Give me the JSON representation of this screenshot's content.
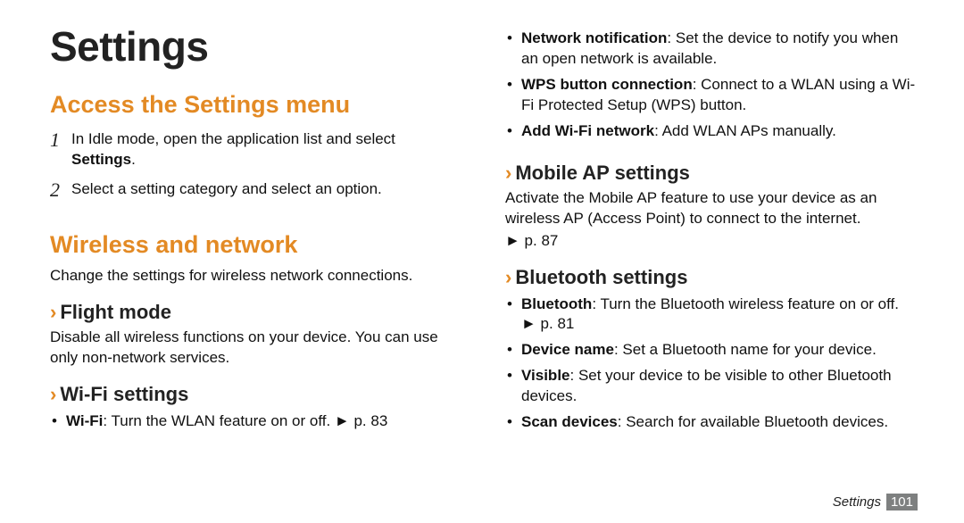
{
  "page_title": "Settings",
  "left": {
    "section1": {
      "heading": "Access the Settings menu",
      "steps": [
        {
          "num": "1",
          "pre": "In Idle mode, open the application list and select ",
          "bold": "Settings",
          "post": "."
        },
        {
          "num": "2",
          "text": "Select a setting category and select an option."
        }
      ]
    },
    "section2": {
      "heading": "Wireless and network",
      "intro": "Change the settings for wireless network connections.",
      "sub_flight": {
        "heading": "Flight mode",
        "body": "Disable all wireless functions on your device. You can use only non-network services."
      },
      "sub_wifi": {
        "heading": "Wi-Fi settings",
        "items": [
          {
            "bold": "Wi-Fi",
            "rest": ": Turn the WLAN feature on or off. ► p. 83"
          }
        ]
      }
    }
  },
  "right": {
    "wifi_cont": [
      {
        "bold": "Network notification",
        "rest": ": Set the device to notify you when an open network is available."
      },
      {
        "bold": "WPS button connection",
        "rest": ": Connect to a WLAN using a Wi-Fi Protected Setup (WPS) button."
      },
      {
        "bold": "Add Wi-Fi network",
        "rest": ": Add WLAN APs manually."
      }
    ],
    "sub_mobile_ap": {
      "heading": "Mobile AP settings",
      "body": "Activate the Mobile AP feature to use your device as an wireless AP (Access Point) to connect to the internet.",
      "ref": "► p. 87"
    },
    "sub_bluetooth": {
      "heading": "Bluetooth settings",
      "items": [
        {
          "bold": "Bluetooth",
          "rest": ": Turn the Bluetooth wireless feature on or off.",
          "ref": "► p. 81"
        },
        {
          "bold": "Device name",
          "rest": ": Set a Bluetooth name for your device."
        },
        {
          "bold": "Visible",
          "rest": ": Set your device to be visible to other Bluetooth devices."
        },
        {
          "bold": "Scan devices",
          "rest": ": Search for available Bluetooth devices."
        }
      ]
    }
  },
  "footer": {
    "label": "Settings",
    "page": "101"
  }
}
